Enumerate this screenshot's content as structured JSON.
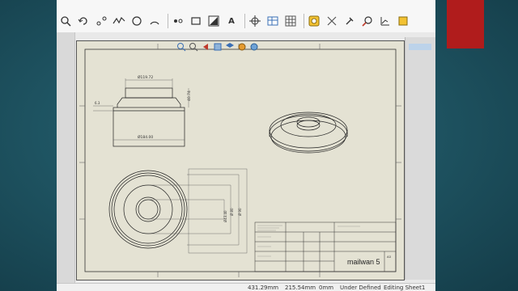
{
  "dimensions": {
    "top_diameter": "Ø119.72",
    "height": "40.74",
    "base_diameter": "Ø184.00",
    "side_small": "6.3",
    "circle_1": "Ø43.40",
    "circle_2": "Ø 80",
    "circle_3": "Ø 90"
  },
  "title_block": {
    "drawing_title": "mailwan 5",
    "size": "A4",
    "sheet_code": "A3"
  },
  "status": {
    "x_coord": "431.29mm",
    "y_coord": "215.54mm",
    "z_coord": "0mm",
    "state": "Under Defined",
    "editing": "Editing Sheet1"
  },
  "colors": {
    "accent": "#b01c1c",
    "sheet": "#e4e2d3",
    "background": "#1f5563"
  },
  "toolbar_icons": [
    "zoom-icon",
    "undo-icon",
    "sketch-icon",
    "spline-icon",
    "circle-icon",
    "arc-icon",
    "point-icon",
    "rectangle-icon",
    "fill-icon",
    "text-icon",
    "target-icon",
    "table-icon",
    "grid-icon",
    "balloon-icon",
    "stamp-icon",
    "pin-icon",
    "search-icon",
    "chart-icon"
  ]
}
